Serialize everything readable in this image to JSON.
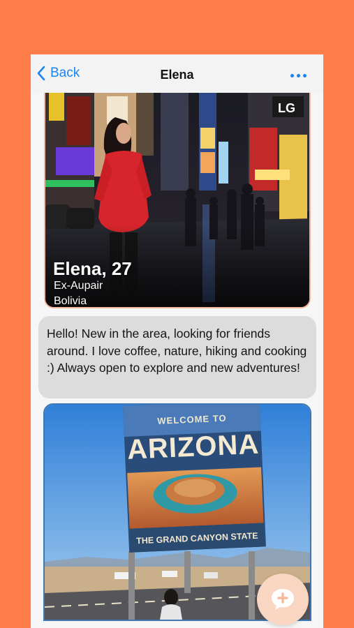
{
  "nav": {
    "back_label": "Back",
    "title": "Elena",
    "more_icon": "more-horizontal-icon",
    "back_icon": "chevron-left-icon"
  },
  "profile": {
    "name_age": "Elena, 27",
    "occupation": "Ex-Aupair",
    "location": "Bolivia",
    "photo_description": "photo"
  },
  "bio": {
    "text": "Hello! New in the area, looking for friends around. I love coffee, nature, hiking and cooking :) Always open to explore and new adventures!"
  },
  "second_photo": {
    "sign_top": "WELCOME TO",
    "sign_main": "ARIZONA",
    "sign_bottom": "THE GRAND CANYON STATE"
  },
  "fab": {
    "icon": "add-chat-icon"
  },
  "colors": {
    "background": "#FF7D4B",
    "accent": "#1A84F0",
    "fab": "#F8D6C1"
  }
}
